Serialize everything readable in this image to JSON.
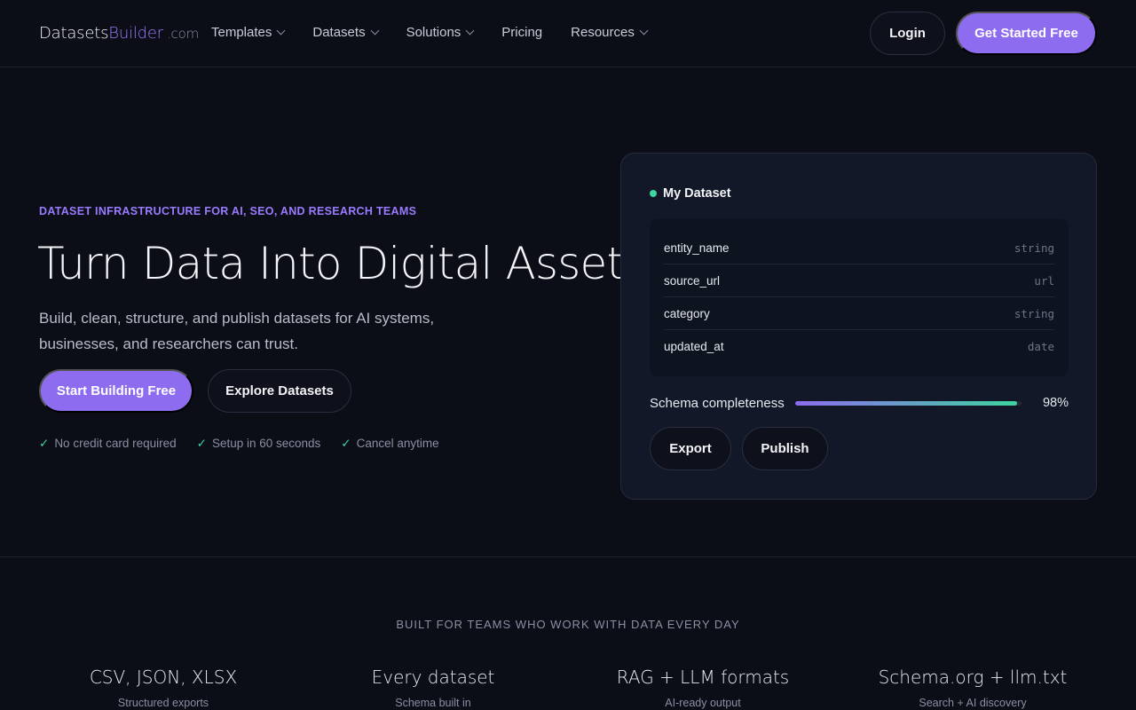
{
  "nav": {
    "logo_main": "Datasets",
    "logo_accent": "Builder",
    "logo_tld": ".com",
    "items": [
      {
        "label": "Templates",
        "dropdown": true
      },
      {
        "label": "Datasets",
        "dropdown": true
      },
      {
        "label": "Solutions",
        "dropdown": true
      },
      {
        "label": "Pricing",
        "dropdown": false
      },
      {
        "label": "Resources",
        "dropdown": true
      }
    ],
    "login_label": "Login",
    "cta_label": "Get Started Free"
  },
  "hero": {
    "eyebrow": "DATASET INFRASTRUCTURE FOR AI, SEO, AND RESEARCH TEAMS",
    "headline": "Turn Data Into Digital Assets",
    "subcopy": "Build, clean, structure, and publish datasets for AI systems, businesses, and researchers can trust.",
    "primary_cta": "Start Building Free",
    "secondary_cta": "Explore Datasets",
    "perks": [
      "No credit card required",
      "Setup in 60 seconds",
      "Cancel anytime"
    ],
    "perk_icon": "✓"
  },
  "card": {
    "title": "My Dataset",
    "fields": [
      {
        "name": "entity_name",
        "type": "string"
      },
      {
        "name": "source_url",
        "type": "url"
      },
      {
        "name": "category",
        "type": "string"
      },
      {
        "name": "updated_at",
        "type": "date"
      }
    ],
    "completeness_label": "Schema completeness",
    "completeness_value": "98%",
    "completeness_fraction": 0.98,
    "export_label": "Export",
    "publish_label": "Publish"
  },
  "teams": {
    "heading": "BUILT FOR TEAMS WHO WORK WITH DATA EVERY DAY",
    "features": [
      {
        "title": "CSV, JSON, XLSX",
        "sub": "Structured exports"
      },
      {
        "title": "Every dataset",
        "sub": "Schema built in"
      },
      {
        "title": "RAG + LLM formats",
        "sub": "AI-ready output"
      },
      {
        "title": "Schema.org + llm.txt",
        "sub": "Search + AI discovery"
      }
    ]
  },
  "colors": {
    "accent": "#8d6cf0",
    "status_green": "#3fd4a0",
    "background": "#0b0e17"
  }
}
